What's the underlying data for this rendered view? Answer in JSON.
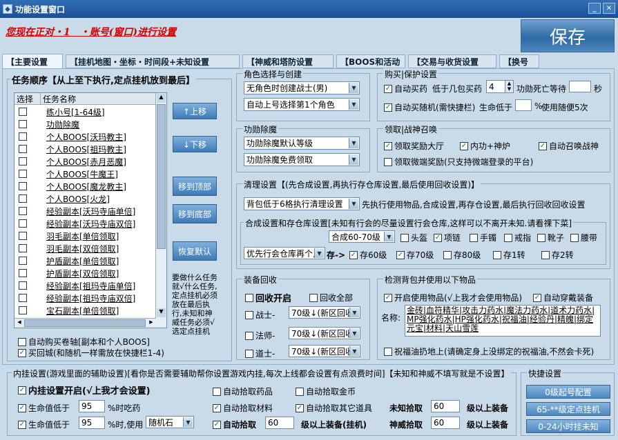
{
  "window": {
    "title": "功能设置窗口"
  },
  "header": {
    "line": "您现在正对・1　・账号(窗口)进行设置",
    "save": "保存"
  },
  "tabs": [
    "【主要设置",
    "【挂机地图・坐标・时间段+未知设置",
    "【神威和塔防设置",
    "【BOOS和活动",
    "【交易与收货设置",
    "【换号"
  ],
  "task": {
    "title": "任务顺序【从上至下执行,定点挂机放到最后】",
    "col_select": "选择",
    "col_name": "任务名称",
    "items": [
      "练小号[1-64级]",
      "功勋除魔",
      "个人BOOS[沃玛教主]",
      "个人BOOS[祖玛教主]",
      "个人BOOS[赤月恶魔]",
      "个人BOOS[牛魔王]",
      "个人BOOS[魔龙教主]",
      "个人BOOS[火龙]",
      "经验副本[沃玛寺庙单倍]",
      "经验副本[沃玛寺庙双倍]",
      "羽毛副本[单倍领取]",
      "羽毛副本[双倍领取]",
      "护盾副本[单倍领取]",
      "护盾副本[双倍领取]",
      "经验副本[祖玛寺庙单倍]",
      "经验副本[祖玛寺庙双倍]",
      "宝石副本[单倍领取]"
    ],
    "btn_up": "↑上移",
    "btn_down": "↓下移",
    "btn_top": "移到顶部",
    "btn_bottom": "移到底部",
    "btn_reset": "恢复默认",
    "note": "要做什么任务就√什么任务,定点挂机必须放在最后执行,未知和神威任务必须√选定点挂机",
    "auto_buy": "自动购买卷轴[副本和个人BOOS]",
    "return_city": "买回城(和随机一样需放在快捷栏1-4)"
  },
  "role": {
    "label": "角色选择与创建",
    "create_sel": "无角色时创建战士(男)",
    "login_sel": "自动上号选择第1个角色"
  },
  "buy": {
    "label": "购买|保护设置",
    "auto_buy_drug": "自动买药",
    "low_text": "低于几包买药",
    "low_val": "4",
    "merit_wait": "功勋死亡等待",
    "sec": "秒",
    "auto_buy_rand": "自动买随机(需快捷栏)",
    "life_low": "生命低于",
    "life_pct": "%",
    "use_rand": "使用随便5次"
  },
  "merit": {
    "label": "功勋除魔",
    "sel1": "功勋除魔默认等级",
    "sel2": "功勋除魔免费领取"
  },
  "reward": {
    "label": "领取|战神召唤",
    "hall": "领取奖励大厅",
    "inner": "内功+神炉",
    "summon": "自动召唤战神",
    "micro": "领取微端奖励(只支持微端登录的平台)"
  },
  "clean": {
    "label": "清理设置【(先合成设置,再执行存仓库设置,最后使用回收设置)】",
    "sel": "背包低于6格执行清理设置",
    "desc": "先执行使用物品,合成设置,再存仓设置,最后执行回收回收设置",
    "compose_label": "合成设置和存仓库设置[未知有行会的尽量设置行会仓库,这样可以不离开未知.请看祼下菜]",
    "compose_sel": "合成60-70级",
    "helmet": "头盔",
    "necklace": "项链",
    "bracelet": "手镯",
    "ring": "戒指",
    "boots": "靴子",
    "belt": "腰带",
    "store_sel": "优先行会仓库再个人",
    "store_arrow": "存->",
    "lv60": "存60级",
    "lv70": "存70级",
    "lv80": "存80级",
    "zhuan1": "存1转",
    "zhuan2": "存2转"
  },
  "recycle": {
    "label": "装备回收",
    "open": "回收开启",
    "all": "回收全部",
    "warrior": "战士-",
    "mage": "法师-",
    "taoist": "道士-",
    "warrior_sel": "70级↓(新区回收",
    "mage_sel": "70级↓(新区回收",
    "taoist_sel": "70级↓(新区回收"
  },
  "detect": {
    "label": "检测背包并使用以下物品",
    "use": "开启使用物品(√上我才会使用物品)",
    "wear": "自动穿戴装备",
    "names_label": "名称:",
    "names": "金砖|血符精华|攻击力药水|魔法力药水|道术力药水|MP强化药水|HP强化药水|祝福油|经验丹|精魄|绑定元宝|材料|天山雪莲",
    "bless": "祝福油扔地上(请确定身上没绑定的祝福油,不然会卡死)"
  },
  "inner": {
    "label": "内挂设置(游戏里面的辅助设置)[看你是否需要辅助帮你设置游戏内挂,每次上线都会设置有点浪费时间]【未知和神威不填写就是不设置】",
    "open": "内挂设置开启(√上我才会设置)",
    "hp1": "生命值低于",
    "hp1_val": "95",
    "hp1_suffix": "%时吃药",
    "hp2": "生命值低于",
    "hp2_val": "95",
    "hp2_suffix": "%时,使用",
    "hp2_sel": "随机石",
    "pick_drug": "自动拾取药品",
    "pick_gold": "自动拾取金币",
    "pick_mat": "自动拾取材料",
    "pick_other": "自动拾取其它道具",
    "unknown_pick": "未知拾取",
    "unknown_val": "60",
    "above1": "级以上装备",
    "auto_pick": "自动拾取",
    "auto_val": "60",
    "above_hang": "级以上装备(挂机)",
    "shenwei_pick": "神威拾取",
    "shenwei_val": "60",
    "above2": "级以上装备"
  },
  "quick": {
    "label": "快捷设置",
    "b1": "0级起号配置",
    "b2": "65-**级定点挂机",
    "b3": "0-24小时挂未知"
  }
}
